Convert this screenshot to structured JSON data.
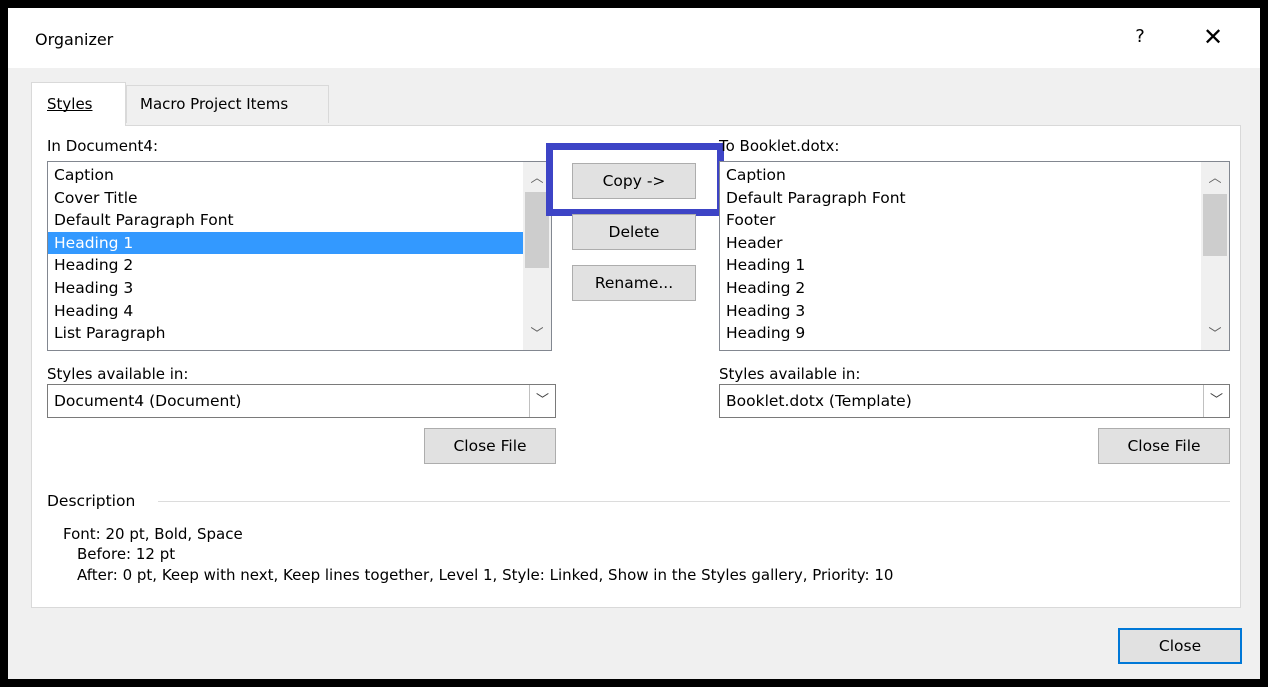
{
  "window": {
    "title": "Organizer",
    "help": "?",
    "close_glyph": "✕"
  },
  "tabs": [
    {
      "label": "Styles",
      "active": true
    },
    {
      "label": "Macro Project Items",
      "active": false
    }
  ],
  "left": {
    "list_label": "In Document4:",
    "items": [
      "Caption",
      "Cover Title",
      "Default Paragraph Font",
      "Heading 1",
      "Heading 2",
      "Heading 3",
      "Heading 4",
      "List Paragraph"
    ],
    "selected_index": 3,
    "available_label": "Styles available in:",
    "available_value": "Document4 (Document)",
    "close_file_label": "Close File"
  },
  "right": {
    "list_label": "To Booklet.dotx:",
    "items": [
      "Caption",
      "Default Paragraph Font",
      "Footer",
      "Header",
      "Heading 1",
      "Heading 2",
      "Heading 3",
      "Heading 9"
    ],
    "available_label": "Styles available in:",
    "available_value": "Booklet.dotx (Template)",
    "close_file_label": "Close File"
  },
  "actions": {
    "copy": "Copy ->",
    "delete": "Delete",
    "rename": "Rename..."
  },
  "description": {
    "label": "Description",
    "lines": [
      "Font: 20 pt, Bold, Space",
      "Before:  12 pt",
      "After:  0 pt, Keep with next, Keep lines together, Level 1, Style: Linked, Show in the Styles gallery, Priority: 10"
    ]
  },
  "footer": {
    "close_label": "Close"
  },
  "colors": {
    "highlight_border": "#3d44c6",
    "selection": "#3399ff",
    "focus_border": "#0078d7"
  }
}
